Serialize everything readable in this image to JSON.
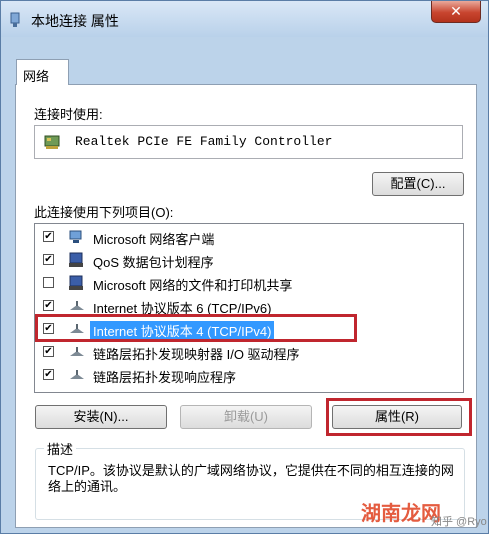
{
  "window": {
    "title": "本地连接 属性",
    "close_symbol": "✕"
  },
  "tabs": [
    {
      "label": "网络",
      "active": true
    }
  ],
  "connect_using": {
    "label": "连接时使用:",
    "adapter": "Realtek PCIe FE Family Controller"
  },
  "buttons": {
    "configure": "配置(C)...",
    "install": "安装(N)...",
    "uninstall": "卸载(U)",
    "properties": "属性(R)"
  },
  "items_label": "此连接使用下列项目(O):",
  "items": [
    {
      "label": "Microsoft 网络客户端",
      "checked": true,
      "icon": "network-client-icon"
    },
    {
      "label": "QoS 数据包计划程序",
      "checked": true,
      "icon": "qos-icon"
    },
    {
      "label": "Microsoft 网络的文件和打印机共享",
      "checked": false,
      "icon": "file-share-icon"
    },
    {
      "label": "Internet 协议版本 6 (TCP/IPv6)",
      "checked": true,
      "icon": "protocol-icon"
    },
    {
      "label": "Internet 协议版本 4 (TCP/IPv4)",
      "checked": true,
      "icon": "protocol-icon",
      "selected": true
    },
    {
      "label": "链路层拓扑发现映射器 I/O 驱动程序",
      "checked": true,
      "icon": "protocol-icon"
    },
    {
      "label": "链路层拓扑发现响应程序",
      "checked": true,
      "icon": "protocol-icon"
    }
  ],
  "description": {
    "title": "描述",
    "text": "TCP/IP。该协议是默认的广域网络协议，它提供在不同的相互连接的网络上的通讯。"
  },
  "watermark": {
    "text": "湖南龙网",
    "sub": "知乎 @Ryo"
  },
  "colors": {
    "selection": "#3399ff",
    "highlight_box": "#c0262e"
  }
}
